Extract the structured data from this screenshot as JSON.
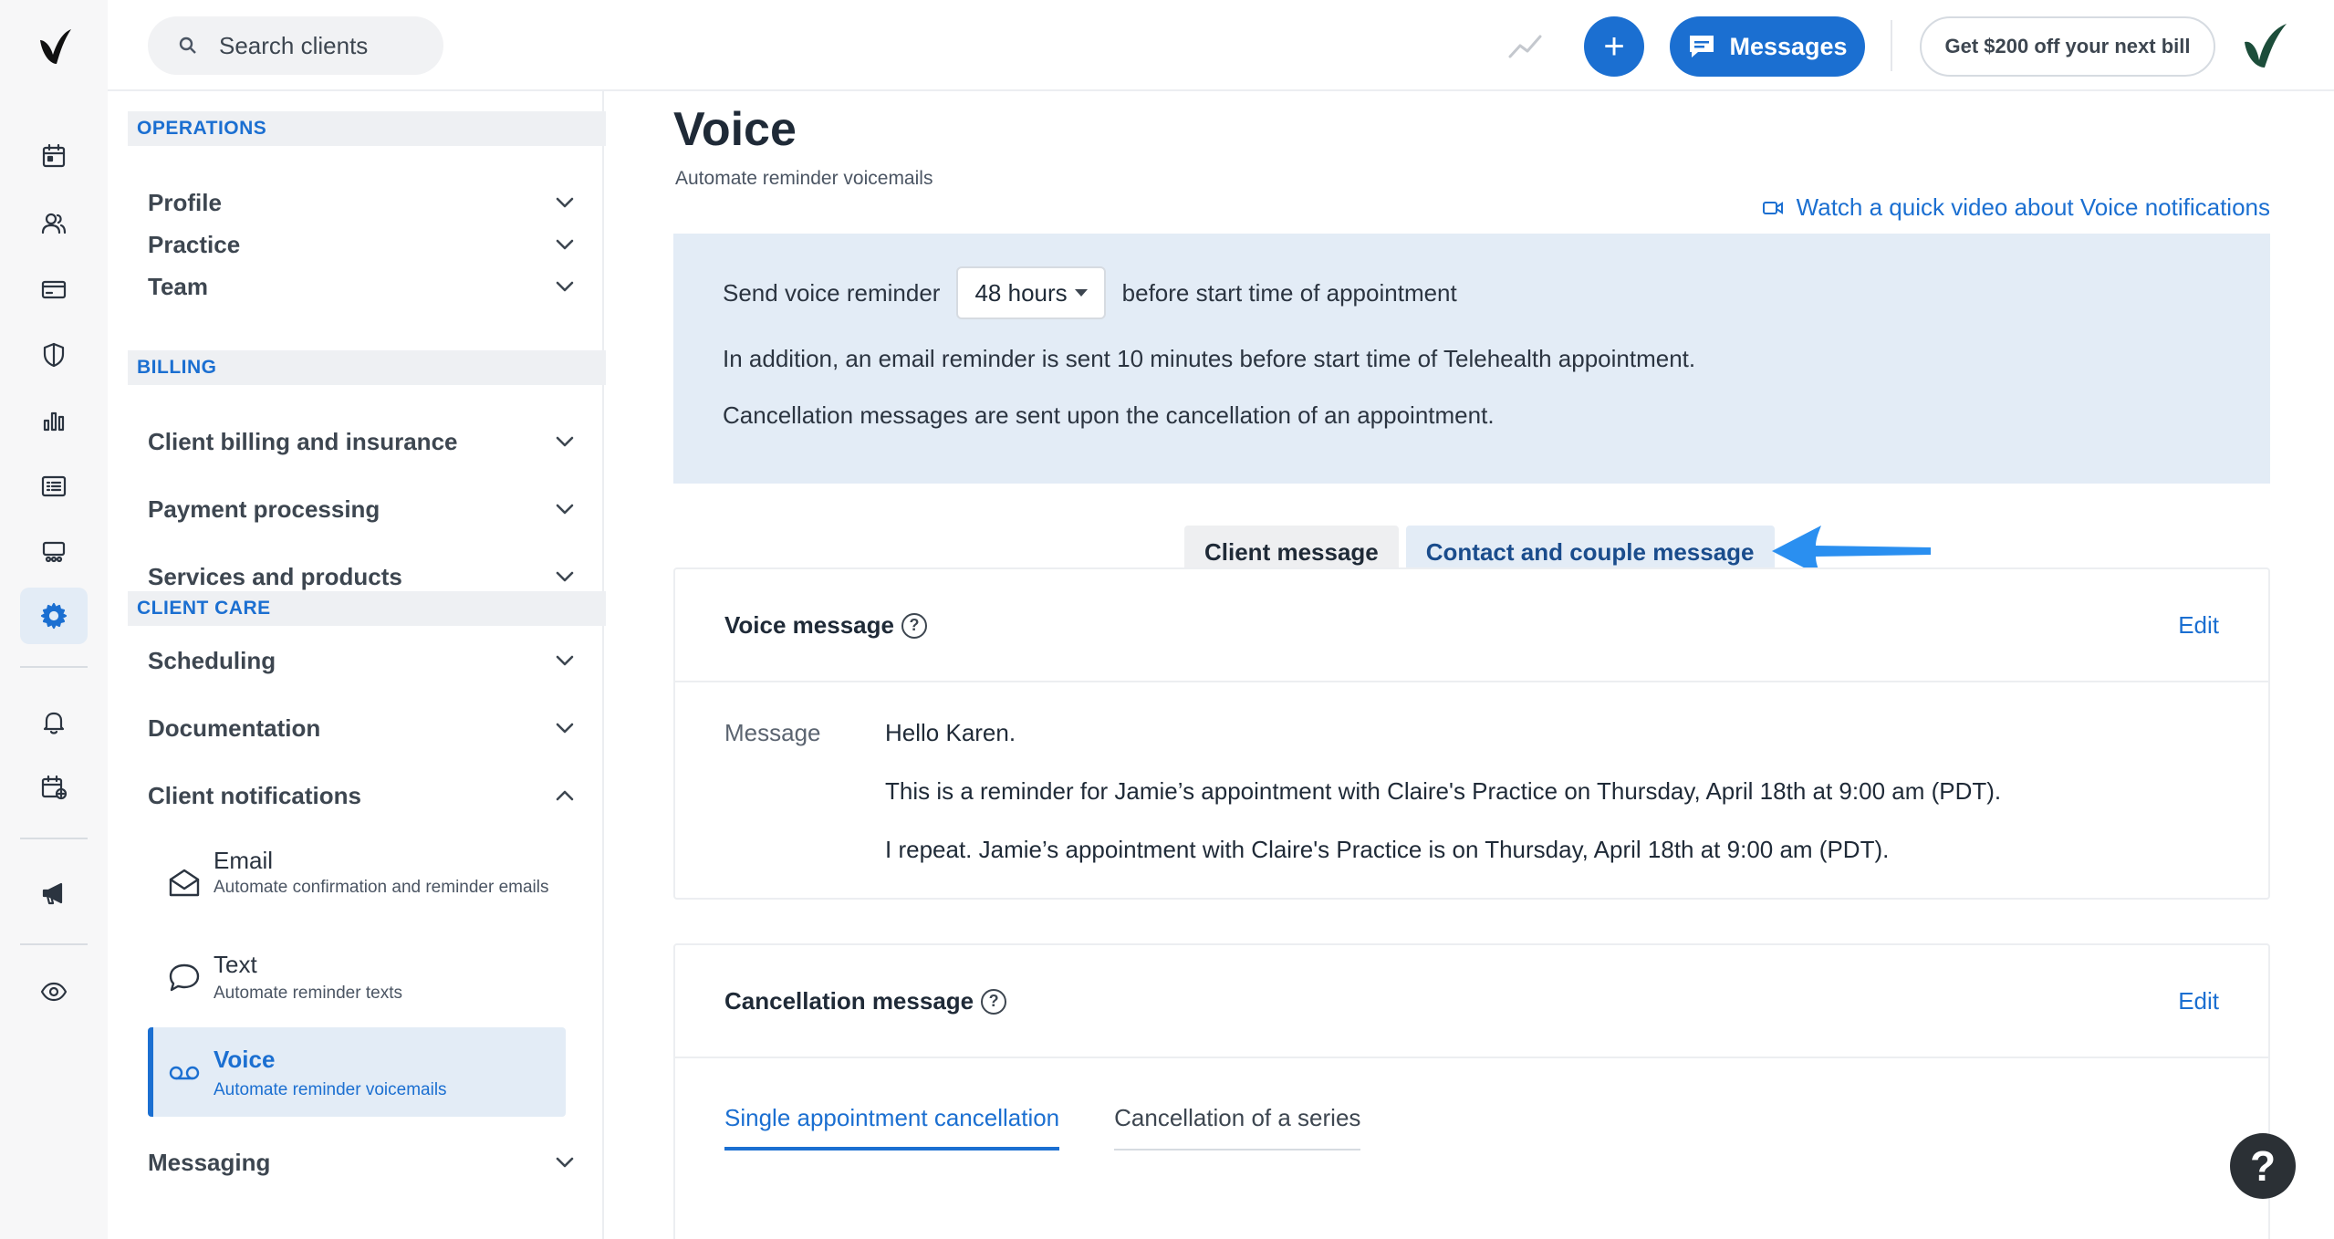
{
  "topbar": {
    "search_placeholder": "Search clients",
    "messages_label": "Messages",
    "promo_label": "Get $200 off your next bill"
  },
  "rail": {
    "icons": [
      "calendar-icon",
      "clients-icon",
      "billing-card-icon",
      "shield-icon",
      "analytics-icon",
      "list-icon",
      "marketplace-icon",
      "settings-gear-icon",
      "bell-icon",
      "calendar-add-icon",
      "megaphone-icon",
      "eye-icon"
    ],
    "active": "settings-gear-icon"
  },
  "sidebar": {
    "sections": {
      "operations": "OPERATIONS",
      "billing": "BILLING",
      "client_care": "CLIENT CARE"
    },
    "items": {
      "profile": "Profile",
      "practice": "Practice",
      "team": "Team",
      "client_billing": "Client billing and insurance",
      "payment_processing": "Payment processing",
      "services_products": "Services and products",
      "scheduling": "Scheduling",
      "documentation": "Documentation",
      "client_notifications": "Client notifications",
      "messaging": "Messaging"
    },
    "notifications": {
      "email_title": "Email",
      "email_desc": "Automate confirmation and reminder emails",
      "text_title": "Text",
      "text_desc": "Automate reminder texts",
      "voice_title": "Voice",
      "voice_desc": "Automate reminder voicemails"
    }
  },
  "main": {
    "title": "Voice",
    "subtitle": "Automate reminder voicemails",
    "video_link": "Watch a quick video about Voice notifications",
    "info": {
      "send_prefix": "Send voice reminder",
      "hours_value": "48 hours",
      "send_suffix": "before start time of appointment",
      "email_note": "In addition, an email reminder is sent 10 minutes before start time of Telehealth appointment.",
      "cancel_note": "Cancellation messages are sent upon the cancellation of an appointment."
    },
    "toggle": {
      "client": "Client message",
      "contact": "Contact and couple message"
    },
    "voice_card": {
      "title": "Voice message",
      "edit": "Edit",
      "message_label": "Message",
      "lines": [
        "Hello Karen.",
        "This is a reminder for Jamie’s appointment with Claire's Practice on Thursday, April 18th at 9:00 am (PDT).",
        "I repeat. Jamie’s appointment with Claire's Practice is on Thursday, April 18th at 9:00 am (PDT)."
      ]
    },
    "cancel_card": {
      "title": "Cancellation message",
      "edit": "Edit",
      "tabs": [
        "Single appointment cancellation",
        "Cancellation of a series"
      ]
    }
  },
  "help_fab": "?",
  "colors": {
    "accent": "#1b6fd1",
    "panel": "#e3ecf6",
    "brand_dark": "#1c4d3a"
  }
}
